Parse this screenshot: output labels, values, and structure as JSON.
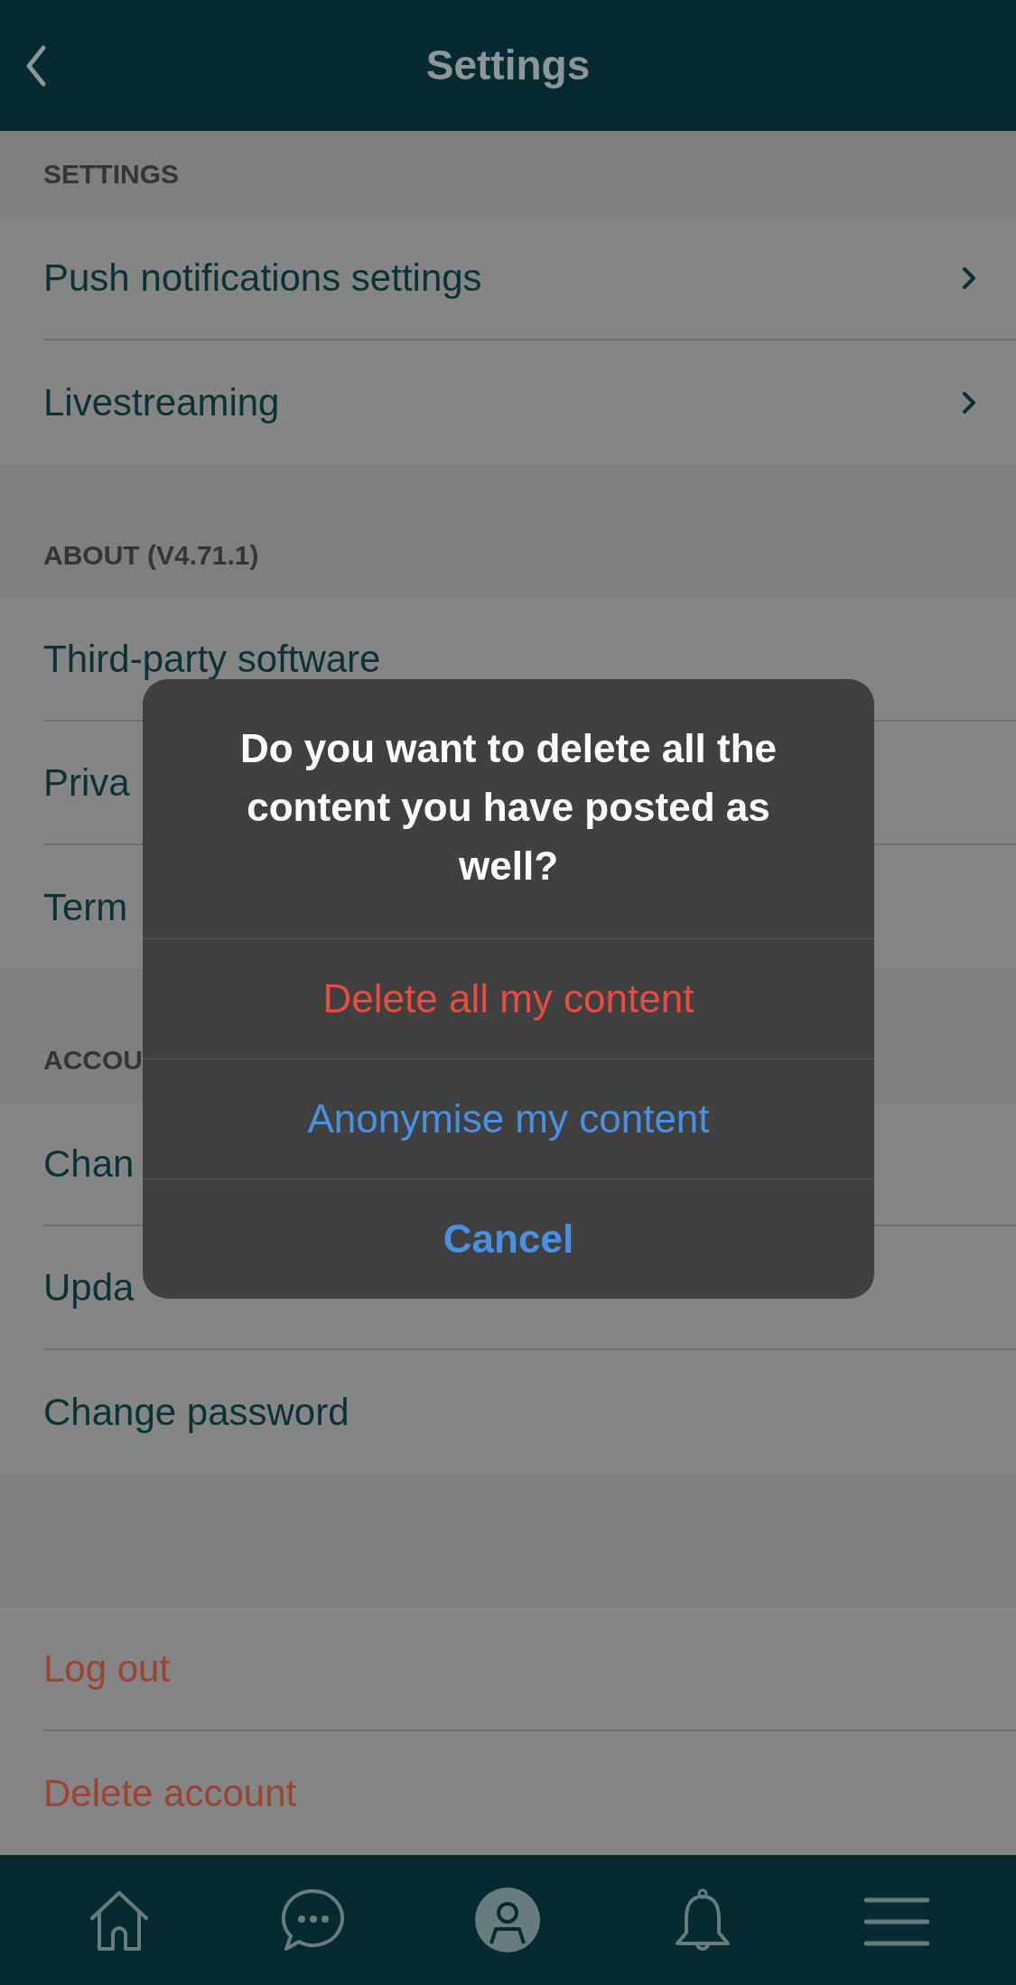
{
  "header": {
    "title": "Settings"
  },
  "sections": [
    {
      "title": "SETTINGS",
      "items": [
        {
          "label": "Push notifications settings",
          "kind": "nav"
        },
        {
          "label": "Livestreaming",
          "kind": "nav"
        }
      ]
    },
    {
      "title": "ABOUT (V4.71.1)",
      "items": [
        {
          "label": "Third-party software",
          "kind": "plain"
        },
        {
          "label": "Priva",
          "kind": "plain"
        },
        {
          "label": "Term",
          "kind": "plain"
        }
      ]
    },
    {
      "title": "ACCOU",
      "items": [
        {
          "label": "Chan",
          "kind": "plain"
        },
        {
          "label": "Upda",
          "kind": "plain"
        },
        {
          "label": "Change password",
          "kind": "plain"
        }
      ]
    },
    {
      "items": [
        {
          "label": "Log out",
          "kind": "danger"
        },
        {
          "label": "Delete account",
          "kind": "danger"
        }
      ]
    }
  ],
  "dialog": {
    "message": "Do you want to delete all the content you have posted as well?",
    "actions": [
      {
        "label": "Delete all my content",
        "kind": "destructive"
      },
      {
        "label": "Anonymise my content",
        "kind": "default"
      },
      {
        "label": "Cancel",
        "kind": "cancel"
      }
    ]
  },
  "tab_bar": [
    {
      "kind": "home",
      "selected": false
    },
    {
      "kind": "chat",
      "selected": false
    },
    {
      "kind": "profile",
      "selected": true
    },
    {
      "kind": "bell",
      "selected": false
    },
    {
      "kind": "menu",
      "selected": false
    }
  ]
}
